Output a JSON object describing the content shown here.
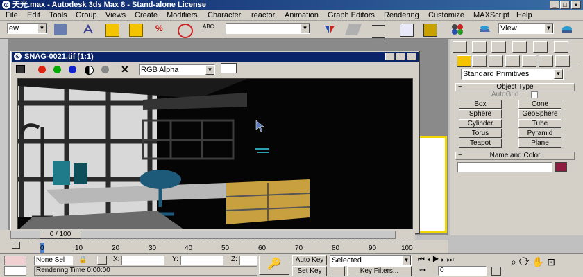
{
  "window": {
    "title": "天光.max - Autodesk 3ds Max 8 - Stand-alone License",
    "minimize": "_",
    "maximize": "□",
    "close": "×"
  },
  "menu": [
    "File",
    "Edit",
    "Tools",
    "Group",
    "Views",
    "Create",
    "Modifiers",
    "Character",
    "reactor",
    "Animation",
    "Graph Editors",
    "Rendering",
    "Customize",
    "MAXScript",
    "Help"
  ],
  "toolbar": {
    "selection_filter": "ew",
    "view_combo": "View",
    "named_selection": ""
  },
  "snag": {
    "title": "SNAG-0021.tif (1:1)",
    "channel": "RGB Alpha"
  },
  "command_panel": {
    "category": "Standard Primitives",
    "object_type_header": "Object Type",
    "autogrid_label": "AutoGrid",
    "buttons": [
      "Box",
      "Cone",
      "Sphere",
      "GeoSphere",
      "Cylinder",
      "Tube",
      "Torus",
      "Pyramid",
      "Teapot",
      "Plane"
    ],
    "name_color_header": "Name and Color",
    "object_color": "#8b1e3f"
  },
  "timeline": {
    "frame_readout": "0 / 100",
    "ticks": [
      "0",
      "10",
      "20",
      "30",
      "40",
      "50",
      "60",
      "70",
      "80",
      "90",
      "100"
    ]
  },
  "status": {
    "selection": "None Sel",
    "x_label": "X:",
    "y_label": "Y:",
    "z_label": "Z:",
    "auto_key": "Auto Key",
    "set_key": "Set Key",
    "key_mode": "Selected",
    "key_filters": "Key Filters...",
    "rendering_time": "Rendering Time  0:00:00",
    "frame": "0"
  }
}
